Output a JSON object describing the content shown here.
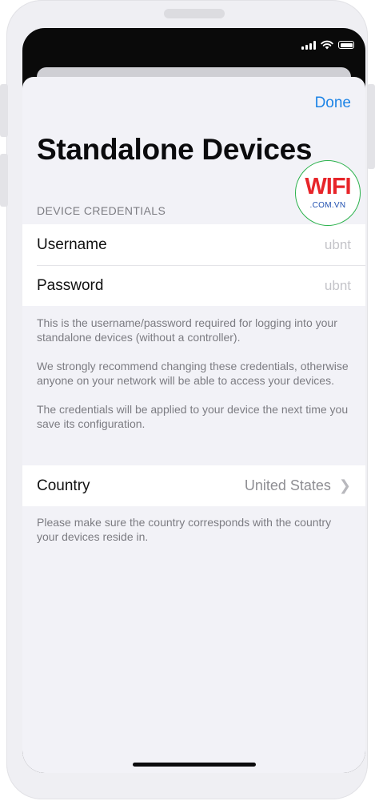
{
  "nav": {
    "done_label": "Done"
  },
  "page_title": "Standalone Devices",
  "credentials": {
    "header": "DEVICE CREDENTIALS",
    "username_label": "Username",
    "username_value": "ubnt",
    "password_label": "Password",
    "password_value": "ubnt",
    "footer_lines": [
      "This is the username/password required for logging into your standalone devices (without a controller).",
      "We strongly recommend changing these credentials, otherwise anyone on your network will be able to access your devices.",
      "The credentials will be applied to your device the next time you save its configuration."
    ]
  },
  "country": {
    "label": "Country",
    "value": "United States",
    "footer": "Please make sure the country corresponds with the country your devices reside in."
  },
  "watermark": {
    "main": "WIFI",
    "sub": ".COM.VN"
  },
  "colors": {
    "accent": "#1d84e6",
    "watermark_red": "#e7252a",
    "watermark_green": "#2bb24c"
  }
}
